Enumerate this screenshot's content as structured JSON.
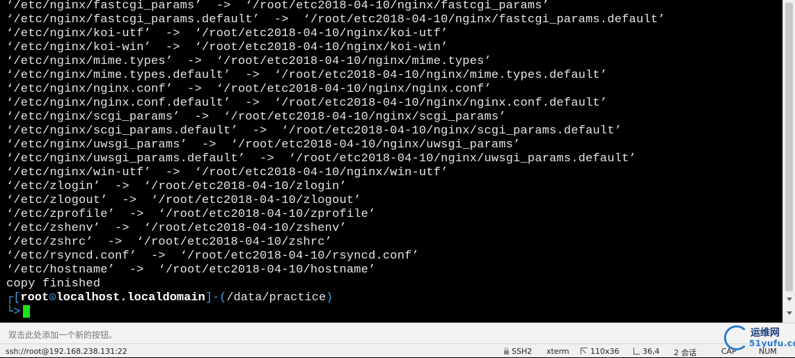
{
  "terminal": {
    "lines": [
      "‘/etc/nginx/fastcgi_params’  ->  ‘/root/etc2018-04-10/nginx/fastcgi_params’",
      "‘/etc/nginx/fastcgi_params.default’  ->  ‘/root/etc2018-04-10/nginx/fastcgi_params.default’",
      "‘/etc/nginx/koi-utf’  ->  ‘/root/etc2018-04-10/nginx/koi-utf’",
      "‘/etc/nginx/koi-win’  ->  ‘/root/etc2018-04-10/nginx/koi-win’",
      "‘/etc/nginx/mime.types’  ->  ‘/root/etc2018-04-10/nginx/mime.types’",
      "‘/etc/nginx/mime.types.default’  ->  ‘/root/etc2018-04-10/nginx/mime.types.default’",
      "‘/etc/nginx/nginx.conf’  ->  ‘/root/etc2018-04-10/nginx/nginx.conf’",
      "‘/etc/nginx/nginx.conf.default’  ->  ‘/root/etc2018-04-10/nginx/nginx.conf.default’",
      "‘/etc/nginx/scgi_params’  ->  ‘/root/etc2018-04-10/nginx/scgi_params’",
      "‘/etc/nginx/scgi_params.default’  ->  ‘/root/etc2018-04-10/nginx/scgi_params.default’",
      "‘/etc/nginx/uwsgi_params’  ->  ‘/root/etc2018-04-10/nginx/uwsgi_params’",
      "‘/etc/nginx/uwsgi_params.default’  ->  ‘/root/etc2018-04-10/nginx/uwsgi_params.default’",
      "‘/etc/nginx/win-utf’  ->  ‘/root/etc2018-04-10/nginx/win-utf’",
      "‘/etc/zlogin’  ->  ‘/root/etc2018-04-10/zlogin’",
      "‘/etc/zlogout’  ->  ‘/root/etc2018-04-10/zlogout’",
      "‘/etc/zprofile’  ->  ‘/root/etc2018-04-10/zprofile’",
      "‘/etc/zshenv’  ->  ‘/root/etc2018-04-10/zshenv’",
      "‘/etc/zshrc’  ->  ‘/root/etc2018-04-10/zshrc’",
      "‘/etc/rsyncd.conf’  ->  ‘/root/etc2018-04-10/rsyncd.conf’",
      "‘/etc/hostname’  ->  ‘/root/etc2018-04-10/hostname’",
      "copy finished"
    ],
    "prompt": {
      "open": "┌[",
      "user": "root",
      "at": "☮",
      "host": "localhost.localdomain",
      "mid": "]-(",
      "path": "/data/practice",
      "close": ")",
      "arrow": "└>"
    },
    "colors": {
      "background": "#000000",
      "text": "#e6e6e6",
      "prompt_accent": "#3fa3e0",
      "cursor": "#19e619"
    }
  },
  "button_bar": {
    "hint": "双击此处添加一个新的按钮。"
  },
  "status_bar": {
    "connection": "ssh://root@192.168.238.131:22",
    "protocol": "SSH2",
    "terminal_type": "xterm",
    "size": "110x36",
    "cursor_pos": "36,4",
    "sessions": "2 会话",
    "caps": "CAP",
    "num": "NUM"
  },
  "watermark": {
    "title": "运维网",
    "subtitle": "51yufu.com"
  }
}
